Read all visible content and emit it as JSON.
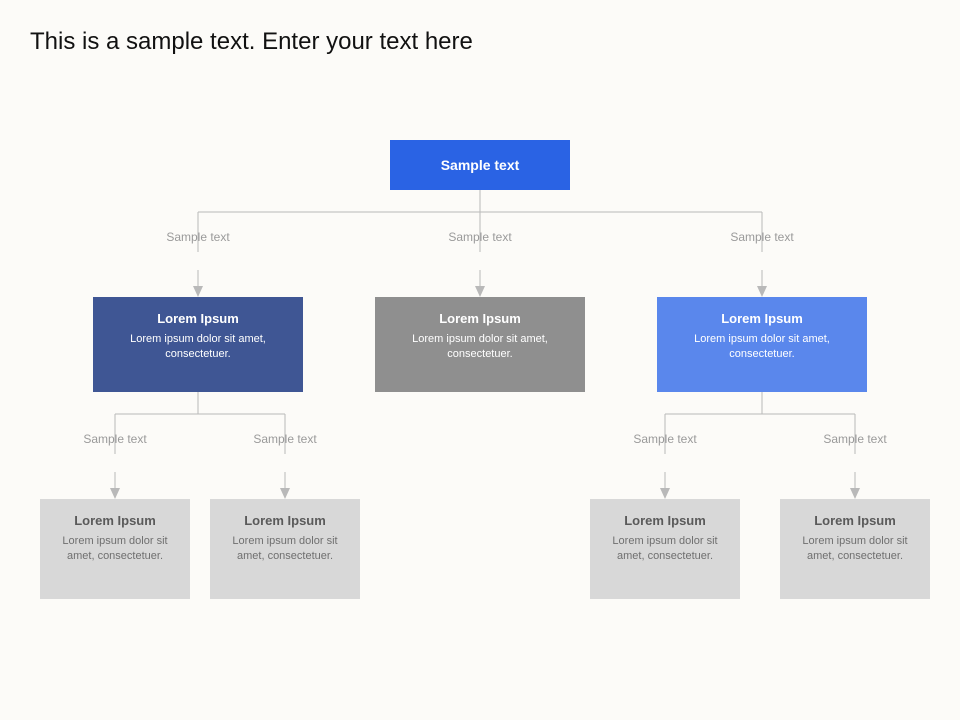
{
  "title": "This is a sample text. Enter your text here",
  "root": {
    "label": "Sample text"
  },
  "edgeLabel": "Sample text",
  "level2": [
    {
      "title": "Lorem Ipsum",
      "body": "Lorem ipsum dolor sit amet, consectetuer."
    },
    {
      "title": "Lorem Ipsum",
      "body": "Lorem ipsum dolor sit amet, consectetuer."
    },
    {
      "title": "Lorem Ipsum",
      "body": "Lorem ipsum dolor sit amet, consectetuer."
    }
  ],
  "level3": [
    {
      "title": "Lorem Ipsum",
      "body": "Lorem ipsum dolor sit amet, consectetuer."
    },
    {
      "title": "Lorem Ipsum",
      "body": "Lorem ipsum dolor sit amet, consectetuer."
    },
    {
      "title": "Lorem Ipsum",
      "body": "Lorem ipsum dolor sit amet, consectetuer."
    },
    {
      "title": "Lorem Ipsum",
      "body": "Lorem ipsum dolor sit amet, consectetuer."
    }
  ],
  "colors": {
    "root": "#2a63e4",
    "darkblue": "#3f5694",
    "gray": "#8f8f8f",
    "blue": "#5a87ec",
    "leaf": "#d8d8d8"
  }
}
